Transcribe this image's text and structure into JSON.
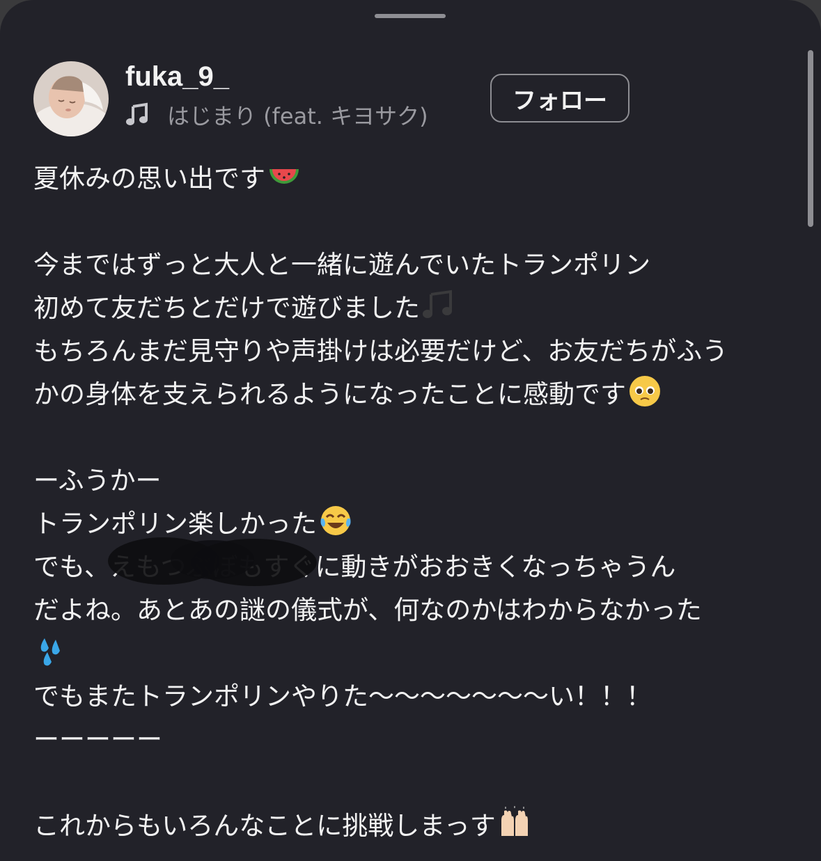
{
  "post": {
    "username": "fuka_9_",
    "music_icon": "music-note-icon",
    "music_title": "はじまり (feat. キヨサク)",
    "follow_label": "フォロー"
  },
  "caption": {
    "lines": [
      "夏休みの思い出です",
      "",
      "今まではずっと大人と一緒に遊んでいたトランポリン",
      "初めて友だちとだけで遊びました",
      "もちろんまだ見守りや声掛けは必要だけど、お友だちがふう",
      "かの身体を支えられるようになったことに感動です",
      "",
      "ーふうかー",
      "トランポリン楽しかった",
      "でも、えもつぶぼもすぐに動きがおおきくなっちゃうん",
      "だよね。あとあの謎の儀式が、何なのかはわからなかった",
      "",
      "でもまたトランポリンやりた〜〜〜〜〜〜〜い！！！",
      "ーーーーー",
      "",
      "これからもいろんなことに挑戦しまっす"
    ],
    "emojis": {
      "line0": "watermelon-emoji",
      "line3": "musical-notes-emoji",
      "line5": "pleading-face-emoji",
      "line8": "tears-of-joy-emoji",
      "line11": "sweat-droplets-emoji",
      "line15": "raising-hands-emoji"
    }
  }
}
